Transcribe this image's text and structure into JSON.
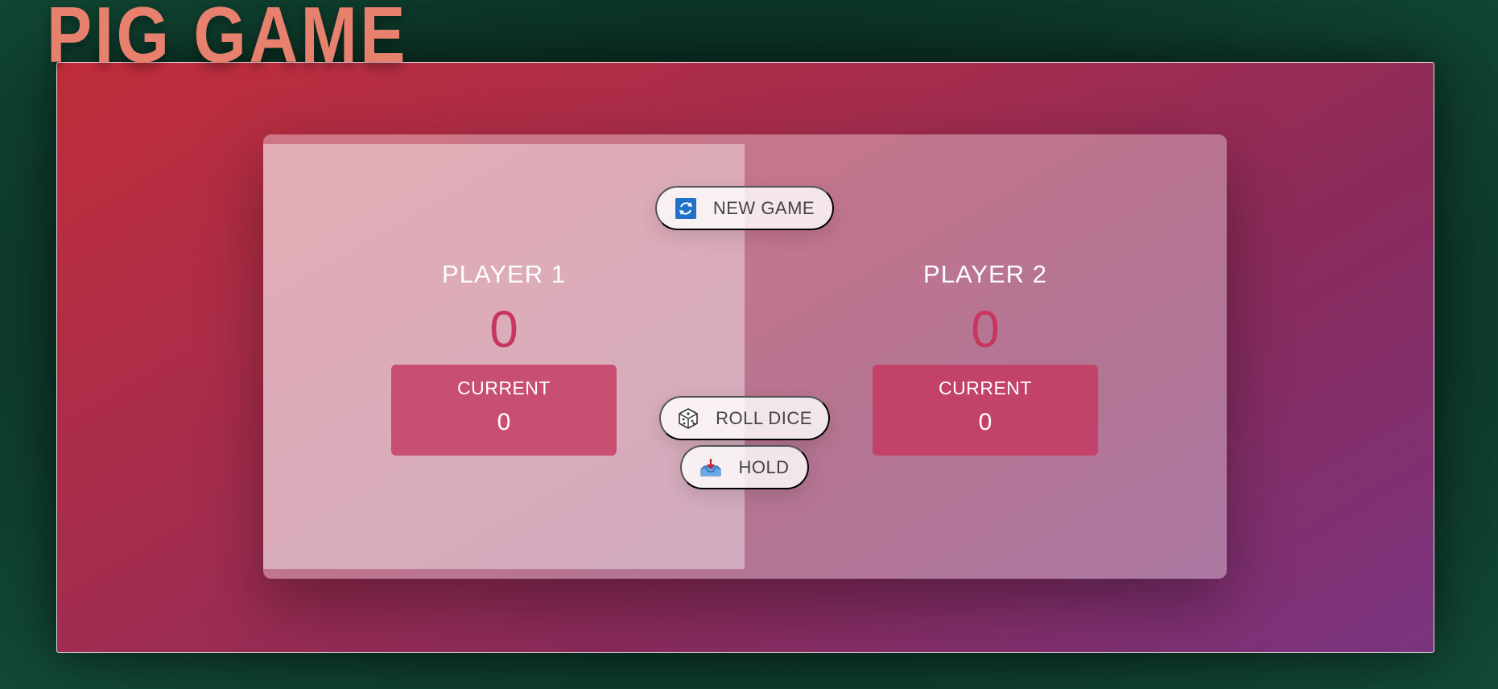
{
  "app": {
    "title": "PIG GAME"
  },
  "players": [
    {
      "name": "PLAYER 1",
      "score": "0",
      "current_label": "CURRENT",
      "current_score": "0",
      "active": true
    },
    {
      "name": "PLAYER 2",
      "score": "0",
      "current_label": "CURRENT",
      "current_score": "0",
      "active": false
    }
  ],
  "controls": {
    "new_game": {
      "label": "NEW GAME",
      "icon": "refresh-icon"
    },
    "roll_dice": {
      "label": "ROLL DICE",
      "icon": "dice-icon"
    },
    "hold": {
      "label": "HOLD",
      "icon": "inbox-tray-icon"
    }
  },
  "colors": {
    "title": "#e8806e",
    "score": "#c7365f",
    "current_box": "#c84e72"
  }
}
